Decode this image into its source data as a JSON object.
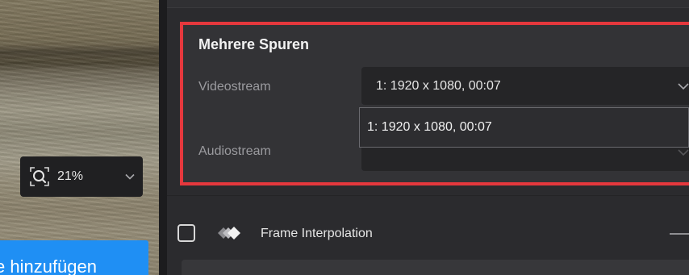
{
  "preview": {
    "zoom_value": "21%",
    "zoom_icon": "magnifier-icon",
    "add_button_label": "e hinzufügen"
  },
  "multi_track": {
    "title": "Mehrere Spuren",
    "video_label": "Videostream",
    "video_value": "1: 1920 x 1080,  00:07",
    "audio_label": "Audiostream",
    "dropdown_options": [
      "1: 1920 x 1080,  00:07"
    ]
  },
  "frame_interpolation": {
    "label": "Frame Interpolation",
    "checked": false,
    "icon": "diamond-layers-icon"
  },
  "colors": {
    "highlight_border": "#e5383d",
    "primary_button": "#1f8ff4",
    "panel_bg": "#2b2b2e"
  }
}
